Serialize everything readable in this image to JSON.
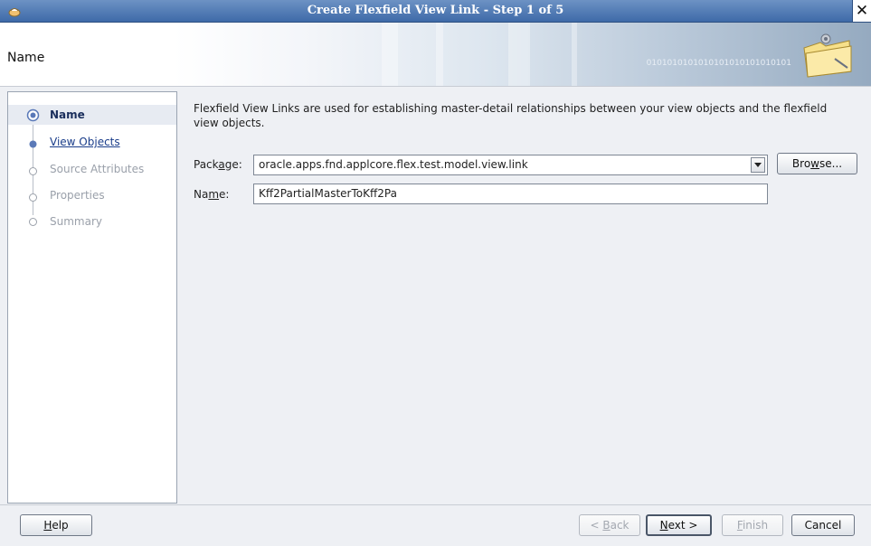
{
  "window": {
    "title": "Create Flexfield View Link - Step 1 of 5",
    "close_glyph": "✕"
  },
  "header": {
    "title": "Name",
    "banner_bits": "0101010101010101010101010101"
  },
  "nav": {
    "steps": [
      {
        "label": "Name",
        "state": "active"
      },
      {
        "label": "View Objects",
        "state": "link"
      },
      {
        "label": "Source Attributes",
        "state": "disabled"
      },
      {
        "label": "Properties",
        "state": "disabled"
      },
      {
        "label": "Summary",
        "state": "disabled"
      }
    ]
  },
  "main": {
    "description": "Flexfield View Links are used for establishing master-detail relationships between your view objects and the flexfield view objects.",
    "package_label_pre": "Pack",
    "package_label_mn": "a",
    "package_label_post": "ge:",
    "package_value": "oracle.apps.fnd.applcore.flex.test.model.view.link",
    "name_label_pre": "Na",
    "name_label_mn": "m",
    "name_label_post": "e:",
    "name_value": "Kff2PartialMasterToKff2Pa",
    "browse_pre": "Bro",
    "browse_mn": "w",
    "browse_post": "se..."
  },
  "footer": {
    "help_mn": "H",
    "help_post": "elp",
    "back_pre": "< ",
    "back_mn": "B",
    "back_post": "ack",
    "next_mn": "N",
    "next_post": "ext >",
    "finish_mn": "F",
    "finish_post": "inish",
    "cancel": "Cancel"
  }
}
